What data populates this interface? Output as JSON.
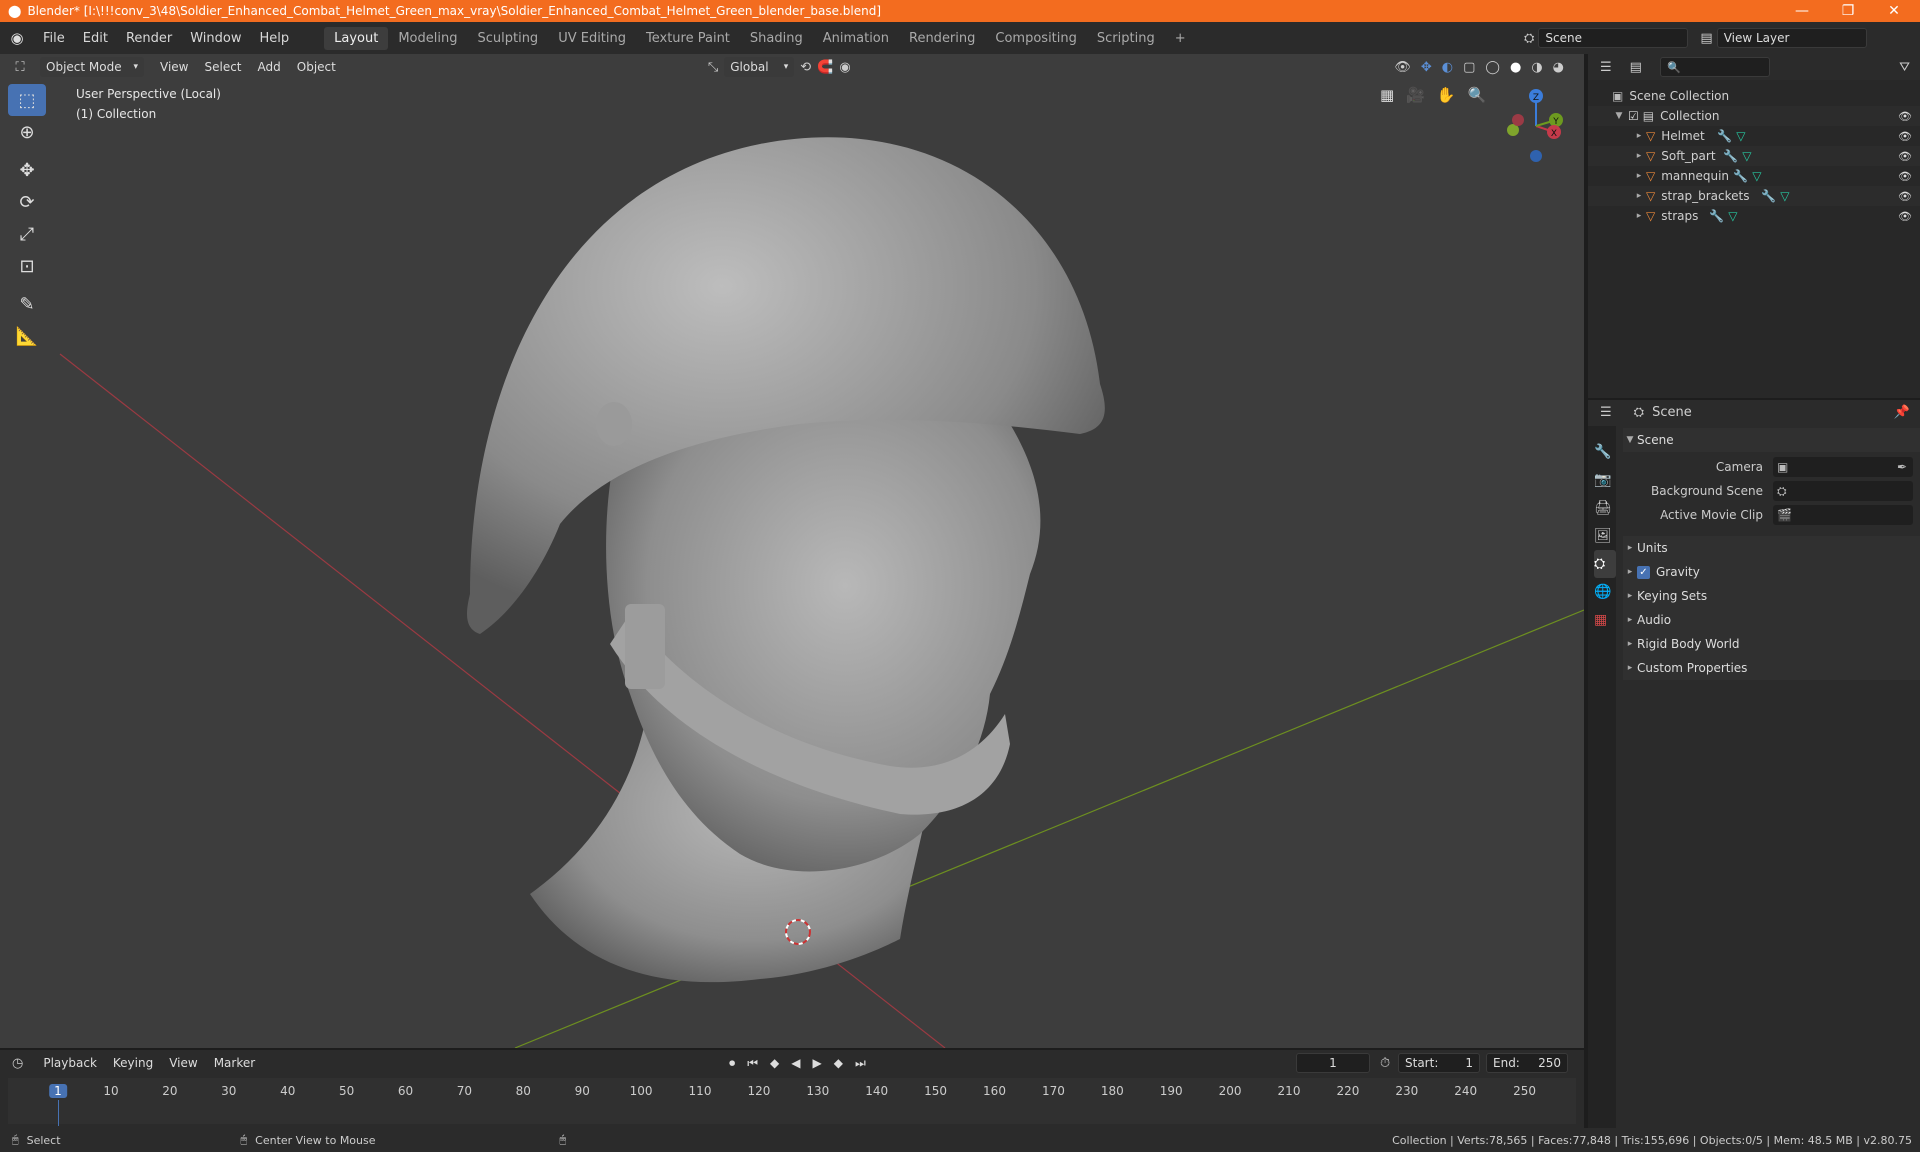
{
  "window": {
    "title": "Blender* [I:\\!!!conv_3\\48\\Soldier_Enhanced_Combat_Helmet_Green_max_vray\\Soldier_Enhanced_Combat_Helmet_Green_blender_base.blend]",
    "minimize": "—",
    "maximize": "❐",
    "close": "✕"
  },
  "menus": [
    "File",
    "Edit",
    "Render",
    "Window",
    "Help"
  ],
  "workspaces": [
    "Layout",
    "Modeling",
    "Sculpting",
    "UV Editing",
    "Texture Paint",
    "Shading",
    "Animation",
    "Rendering",
    "Compositing",
    "Scripting"
  ],
  "active_workspace": "Layout",
  "add_workspace": "+",
  "scene_field": "Scene",
  "view_layer_field": "View Layer",
  "viewport": {
    "mode": "Object Mode",
    "menu": [
      "View",
      "Select",
      "Add",
      "Object"
    ],
    "transform_orientation": "Global",
    "perspective_label": "User Perspective (Local)",
    "collection_label": "(1) Collection",
    "gizmo": {
      "x": "X",
      "y": "Y",
      "z": "Z"
    }
  },
  "outliner": {
    "search_placeholder": "",
    "root": "Scene Collection",
    "collection": "Collection",
    "objects": [
      "Helmet",
      "Soft_part",
      "mannequin",
      "strap_brackets",
      "straps"
    ]
  },
  "properties": {
    "header": "Scene",
    "panel_scene": "Scene",
    "camera_label": "Camera",
    "background_scene_label": "Background Scene",
    "active_movie_clip_label": "Active Movie Clip",
    "panels": [
      "Units",
      "Gravity",
      "Keying Sets",
      "Audio",
      "Rigid Body World",
      "Custom Properties"
    ],
    "gravity_checked": true
  },
  "timeline": {
    "menus": [
      "Playback",
      "Keying",
      "View",
      "Marker"
    ],
    "current_frame": "1",
    "start_label": "Start:",
    "start": "1",
    "end_label": "End:",
    "end": "250",
    "ticks": [
      "1",
      "10",
      "20",
      "30",
      "40",
      "50",
      "60",
      "70",
      "80",
      "90",
      "100",
      "110",
      "120",
      "130",
      "140",
      "150",
      "160",
      "170",
      "180",
      "190",
      "200",
      "210",
      "220",
      "230",
      "240",
      "250"
    ]
  },
  "statusbar": {
    "select": "Select",
    "center_view": "Center View to Mouse",
    "stats": "Collection | Verts:78,565 | Faces:77,848 | Tris:155,696 | Objects:0/5 | Mem: 48.5 MB | v2.80.75"
  },
  "colors": {
    "titlebar": "#f36c1f",
    "accent_blue": "#4772b3",
    "object_orange": "#e8873a",
    "x_axis": "#c53a4a",
    "y_axis": "#6d9a1f",
    "z_axis": "#3b7ddb"
  }
}
